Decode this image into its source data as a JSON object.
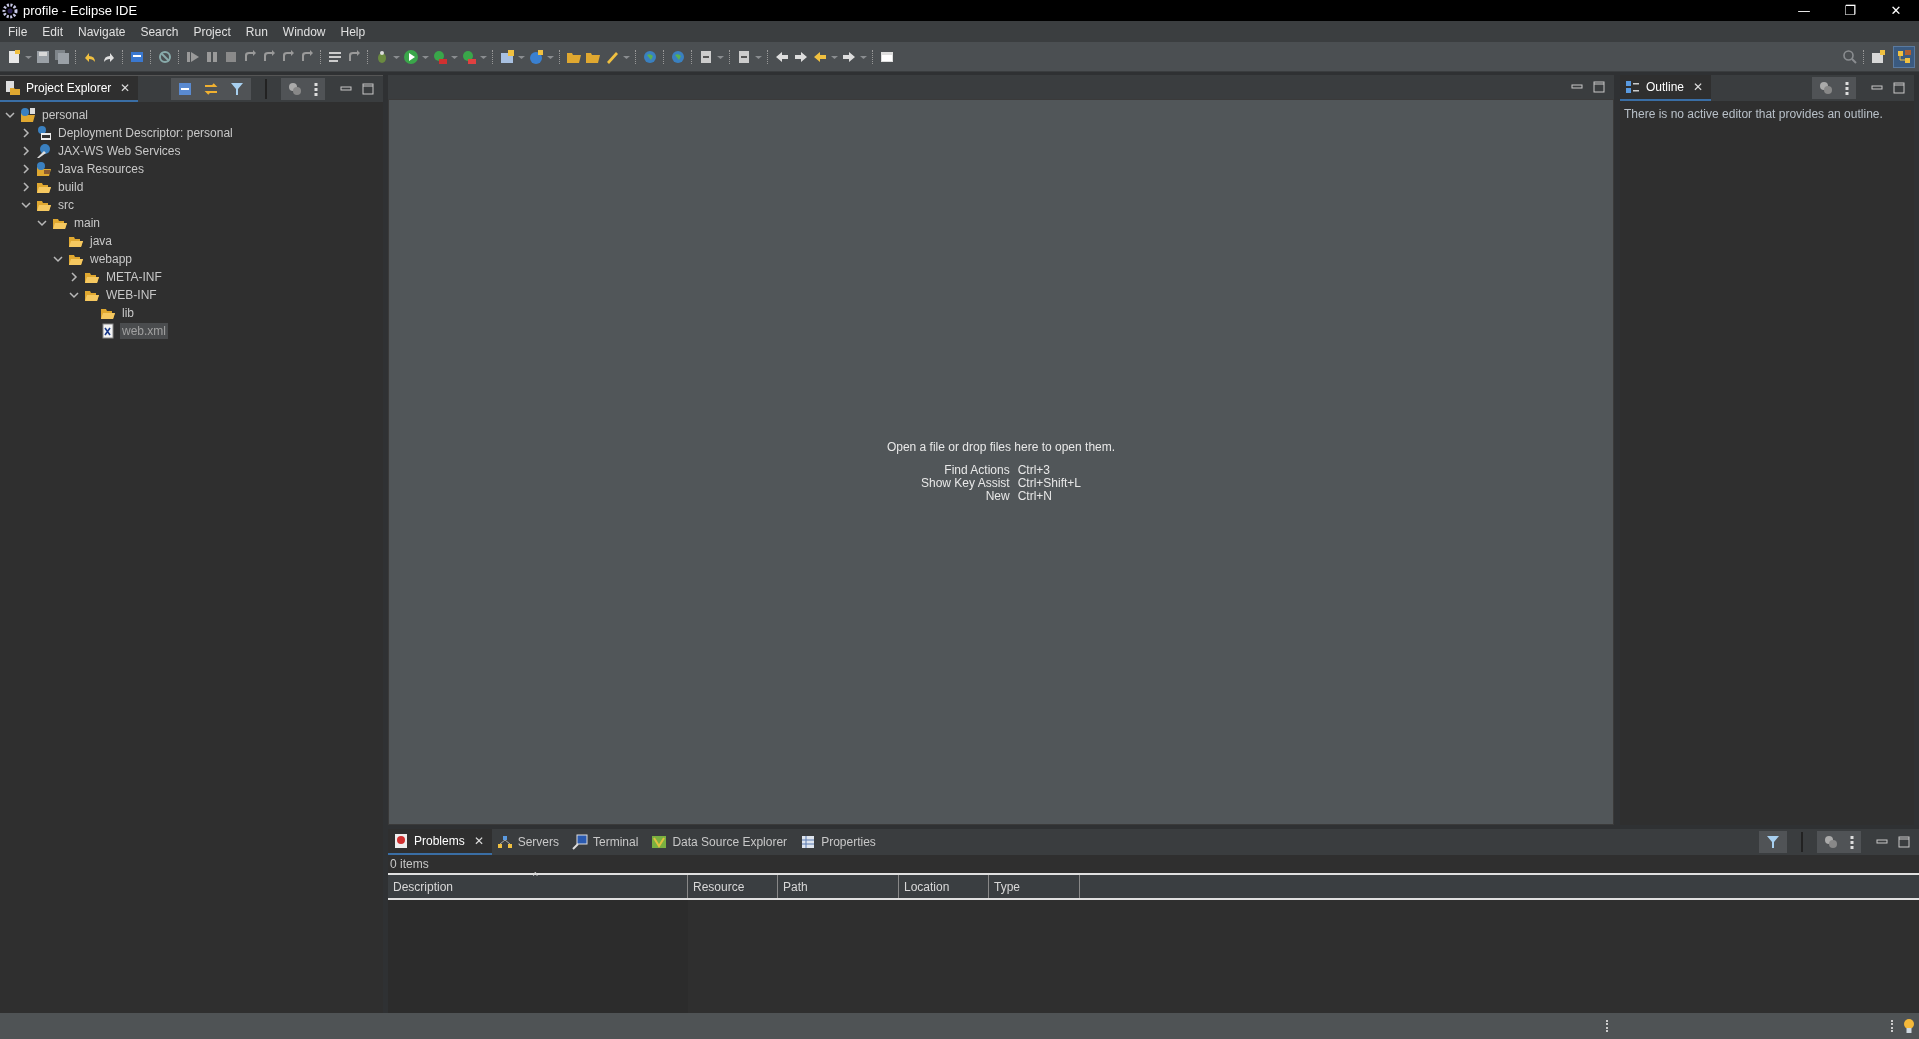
{
  "window": {
    "title": "profile - Eclipse IDE",
    "controls": [
      "—",
      "❐",
      "✕"
    ]
  },
  "menu": [
    "File",
    "Edit",
    "Navigate",
    "Search",
    "Project",
    "Run",
    "Window",
    "Help"
  ],
  "project_explorer": {
    "tab": {
      "label": "Project Explorer",
      "close": "✕",
      "selected": true
    },
    "tree": [
      {
        "label": "personal",
        "kind": "project",
        "expanded": true,
        "selected": false,
        "children": [
          {
            "label": "Deployment Descriptor: personal",
            "kind": "descriptor",
            "expanded": false,
            "selected": false
          },
          {
            "label": "JAX-WS Web Services",
            "kind": "webservices",
            "expanded": false,
            "selected": false
          },
          {
            "label": "Java Resources",
            "kind": "resources",
            "expanded": false,
            "selected": false
          },
          {
            "label": "build",
            "kind": "folder",
            "expanded": false,
            "selected": false
          },
          {
            "label": "src",
            "kind": "folder",
            "expanded": true,
            "selected": false,
            "children": [
              {
                "label": "main",
                "kind": "folder",
                "expanded": true,
                "selected": false,
                "children": [
                  {
                    "label": "java",
                    "kind": "folder",
                    "selected": false
                  },
                  {
                    "label": "webapp",
                    "kind": "folder",
                    "expanded": true,
                    "selected": false,
                    "children": [
                      {
                        "label": "META-INF",
                        "kind": "folder",
                        "expanded": false,
                        "selected": false
                      },
                      {
                        "label": "WEB-INF",
                        "kind": "folder",
                        "expanded": true,
                        "selected": false,
                        "children": [
                          {
                            "label": "lib",
                            "kind": "folder",
                            "selected": false
                          },
                          {
                            "label": "web.xml",
                            "kind": "xml",
                            "selected": true
                          }
                        ]
                      }
                    ]
                  }
                ]
              }
            ]
          }
        ]
      }
    ]
  },
  "editor": {
    "message": "Open a file or drop files here to open them.",
    "shortcuts": [
      {
        "action": "Find Actions",
        "keys": "Ctrl+3"
      },
      {
        "action": "Show Key Assist",
        "keys": "Ctrl+Shift+L"
      },
      {
        "action": "New",
        "keys": "Ctrl+N"
      }
    ]
  },
  "outline": {
    "tab": {
      "label": "Outline",
      "close": "✕",
      "selected": true
    },
    "message": "There is no active editor that provides an outline."
  },
  "bottom_panel": {
    "tabs": [
      {
        "label": "Problems",
        "kind": "problems",
        "selected": true,
        "close": "✕"
      },
      {
        "label": "Servers",
        "kind": "servers",
        "selected": false
      },
      {
        "label": "Terminal",
        "kind": "terminal",
        "selected": false
      },
      {
        "label": "Data Source Explorer",
        "kind": "datasource",
        "selected": false
      },
      {
        "label": "Properties",
        "kind": "properties",
        "selected": false
      }
    ],
    "count": "0 items",
    "sort_mark": "^",
    "columns": [
      "Description",
      "Resource",
      "Path",
      "Location",
      "Type"
    ]
  }
}
